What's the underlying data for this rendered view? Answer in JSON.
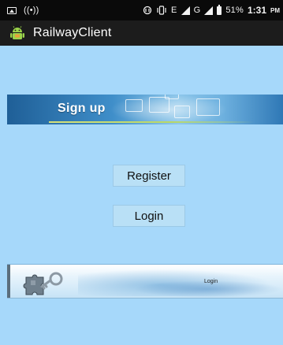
{
  "status_bar": {
    "left_icons": [
      "image-icon",
      "wifi-hotspot-icon"
    ],
    "hotspot_text": "((•))",
    "network_text": "E",
    "network2_text": "G",
    "battery_percent": "51%",
    "time": "1:31",
    "ampm": "PM"
  },
  "app_bar": {
    "title": "RailwayClient",
    "icon": "android-icon"
  },
  "signup_banner": {
    "title": "Sign up"
  },
  "buttons": {
    "register": "Register",
    "login": "Login"
  },
  "login_strip": {
    "label": "Login",
    "icon": "puzzle-key-icon"
  },
  "colors": {
    "background": "#a6d8fa",
    "status_bar": "#0a0a0a",
    "action_bar": "#1c1c1c",
    "button": "#b9e0f6"
  }
}
